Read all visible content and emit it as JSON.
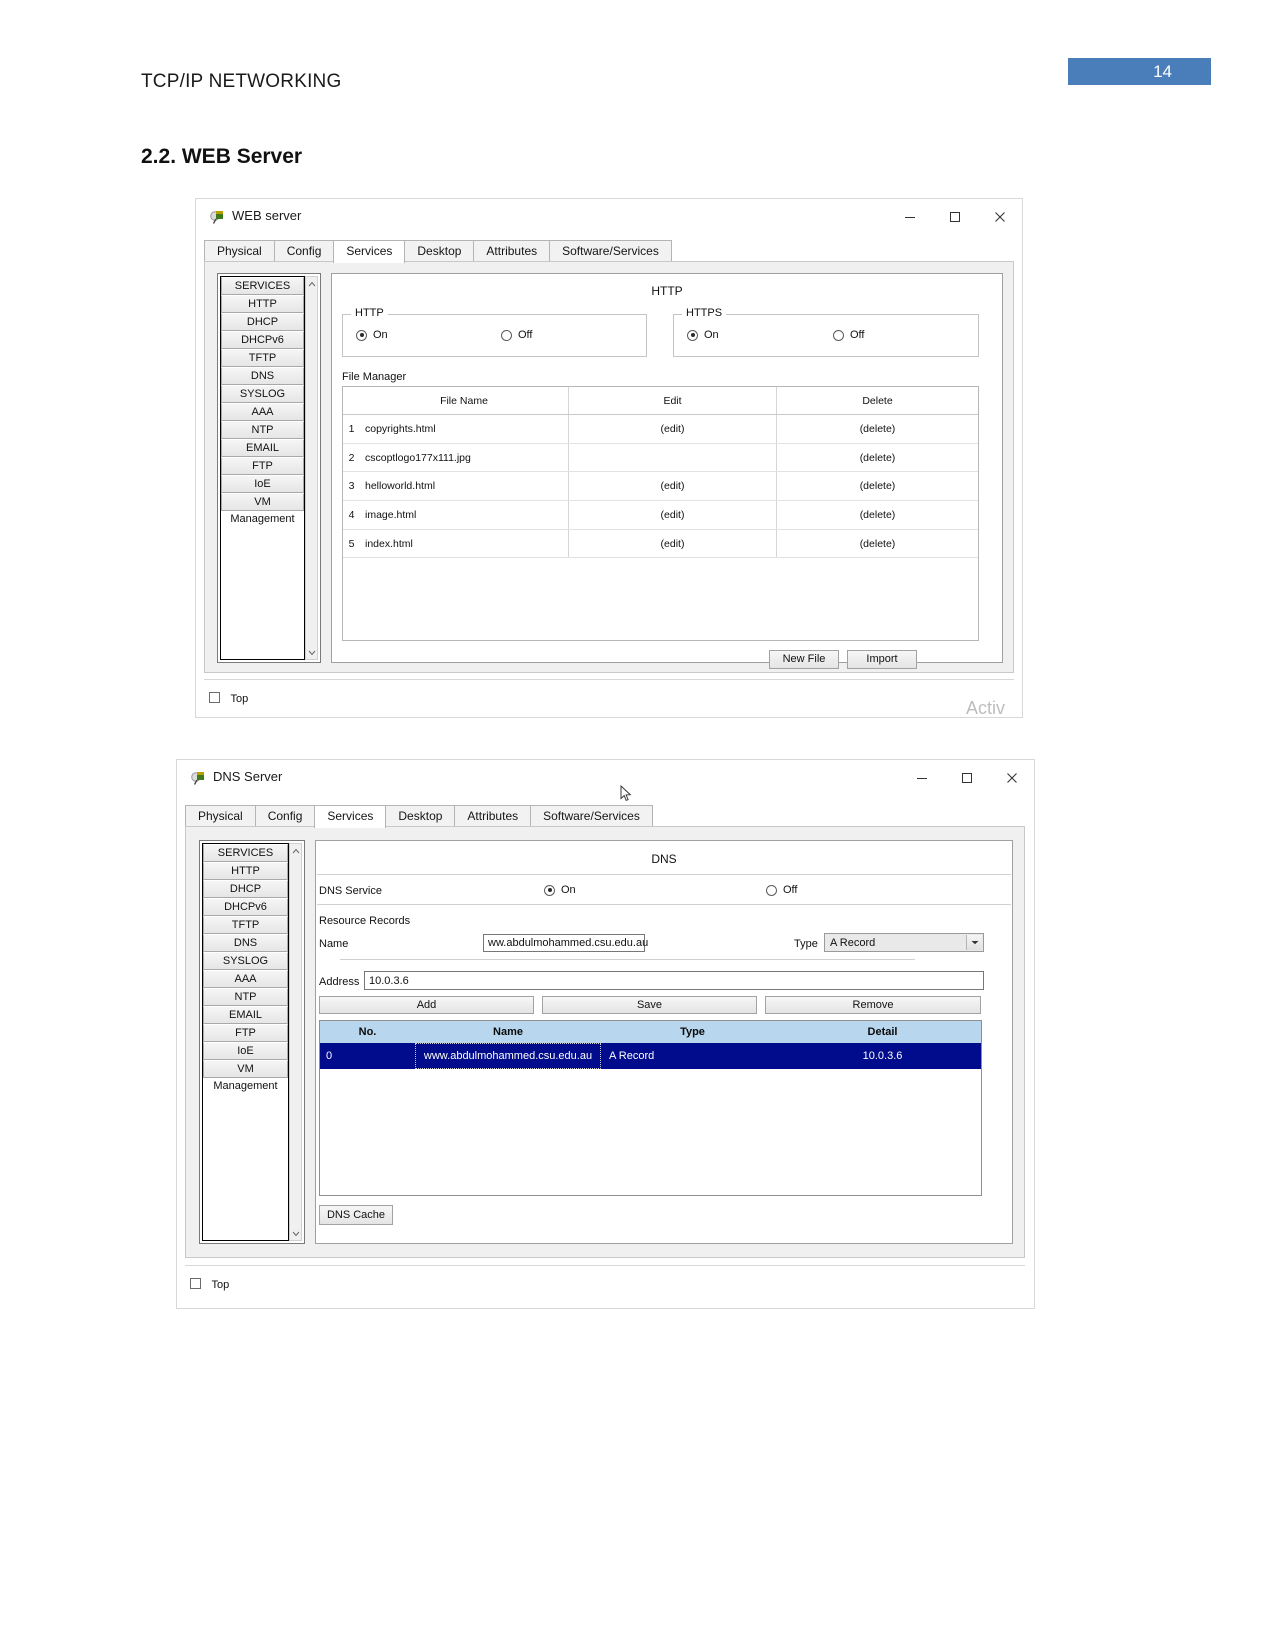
{
  "document": {
    "header_title": "TCP/IP NETWORKING",
    "page_number": "14",
    "page_badge_color": "#4a7ebb",
    "section_heading": "2.2. WEB Server"
  },
  "web_server_window": {
    "title": "WEB server",
    "icon": "packet-tracer-server-icon",
    "controls": {
      "minimize": "–",
      "maximize": "□",
      "close": "✕"
    },
    "tabs": [
      {
        "label": "Physical",
        "active": false
      },
      {
        "label": "Config",
        "active": false
      },
      {
        "label": "Services",
        "active": true
      },
      {
        "label": "Desktop",
        "active": false
      },
      {
        "label": "Attributes",
        "active": false
      },
      {
        "label": "Software/Services",
        "active": false
      }
    ],
    "services_list": [
      "SERVICES",
      "HTTP",
      "DHCP",
      "DHCPv6",
      "TFTP",
      "DNS",
      "SYSLOG",
      "AAA",
      "NTP",
      "EMAIL",
      "FTP",
      "IoE",
      "VM Management"
    ],
    "panel_heading": "HTTP",
    "http_group": {
      "label": "HTTP",
      "on_label": "On",
      "off_label": "Off",
      "selected": "On"
    },
    "https_group": {
      "label": "HTTPS",
      "on_label": "On",
      "off_label": "Off",
      "selected": "On"
    },
    "file_manager": {
      "label": "File Manager",
      "columns": [
        "File Name",
        "Edit",
        "Delete"
      ],
      "rows": [
        {
          "no": "1",
          "file_name": "copyrights.html",
          "edit": "(edit)",
          "delete": "(delete)"
        },
        {
          "no": "2",
          "file_name": "cscoptlogo177x111.jpg",
          "edit": "",
          "delete": "(delete)"
        },
        {
          "no": "3",
          "file_name": "helloworld.html",
          "edit": "(edit)",
          "delete": "(delete)"
        },
        {
          "no": "4",
          "file_name": "image.html",
          "edit": "(edit)",
          "delete": "(delete)"
        },
        {
          "no": "5",
          "file_name": "index.html",
          "edit": "(edit)",
          "delete": "(delete)"
        }
      ]
    },
    "buttons": {
      "new_file": "New File",
      "import": "Import"
    },
    "top_checkbox_label": "Top",
    "watermark": "Activ"
  },
  "dns_server_window": {
    "title": "DNS Server",
    "icon": "packet-tracer-server-icon",
    "controls": {
      "minimize": "–",
      "maximize": "□",
      "close": "✕"
    },
    "tabs": [
      {
        "label": "Physical",
        "active": false
      },
      {
        "label": "Config",
        "active": false
      },
      {
        "label": "Services",
        "active": true
      },
      {
        "label": "Desktop",
        "active": false
      },
      {
        "label": "Attributes",
        "active": false
      },
      {
        "label": "Software/Services",
        "active": false
      }
    ],
    "services_list": [
      "SERVICES",
      "HTTP",
      "DHCP",
      "DHCPv6",
      "TFTP",
      "DNS",
      "SYSLOG",
      "AAA",
      "NTP",
      "EMAIL",
      "FTP",
      "IoE",
      "VM Management"
    ],
    "panel_heading": "DNS",
    "dns_service": {
      "label": "DNS Service",
      "on_label": "On",
      "off_label": "Off",
      "selected": "On"
    },
    "resource_records": {
      "section_label": "Resource Records",
      "name_label": "Name",
      "name_value": "ww.abdulmohammed.csu.edu.au",
      "type_label": "Type",
      "type_value": "A Record",
      "address_label": "Address",
      "address_value": "10.0.3.6"
    },
    "buttons": {
      "add": "Add",
      "save": "Save",
      "remove": "Remove",
      "dns_cache": "DNS Cache"
    },
    "records_table": {
      "columns": [
        "No.",
        "Name",
        "Type",
        "Detail"
      ],
      "header_bg": "#b8d6ee",
      "selected_row_bg": "#000c8c",
      "rows": [
        {
          "no": "0",
          "name": "www.abdulmohammed.csu.edu.au",
          "type": "A Record",
          "detail": "10.0.3.6",
          "selected": true
        }
      ]
    },
    "top_checkbox_label": "Top"
  }
}
